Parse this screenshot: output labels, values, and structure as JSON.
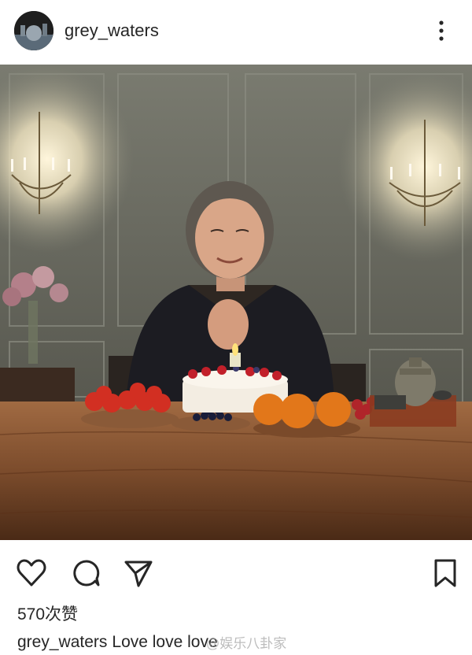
{
  "post": {
    "username": "grey_waters",
    "likes_text": "570次赞",
    "caption_user": "grey_waters",
    "caption_text": "Love love love",
    "watermark_text": "@娱乐八卦家"
  },
  "icons": {
    "avatar": "profile-avatar",
    "more": "more-vertical-icon",
    "like": "heart-icon",
    "comment": "comment-icon",
    "share": "send-icon",
    "save": "bookmark-icon"
  },
  "colors": {
    "text": "#262626",
    "background": "#ffffff",
    "icon_stroke": "#262626"
  }
}
